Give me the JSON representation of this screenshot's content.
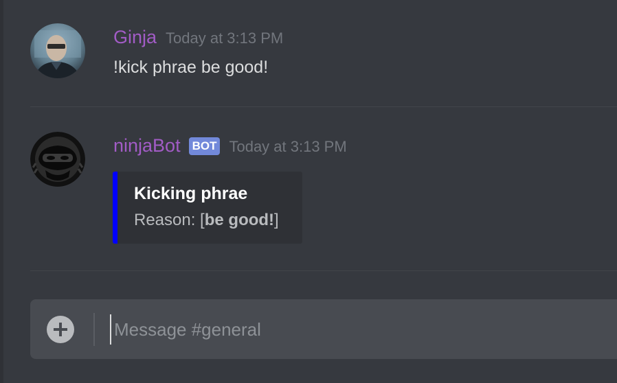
{
  "messages": [
    {
      "username": "Ginja",
      "timestamp": "Today at 3:13 PM",
      "content": "!kick phrae be good!",
      "avatar": "user-photo-avatar"
    },
    {
      "username": "ninjaBot",
      "bot_tag": "BOT",
      "timestamp": "Today at 3:13 PM",
      "avatar": "ninja-mask-avatar",
      "embed": {
        "color": "#0000ff",
        "title": "Kicking phrae",
        "reason_prefix": "Reason: [",
        "reason_bold": "be good!",
        "reason_suffix": "]"
      }
    }
  ],
  "composer": {
    "placeholder": "Message #general",
    "value": "",
    "upload_icon": "plus-circle-icon"
  },
  "colors": {
    "background": "#36393f",
    "username": "#a25cc6",
    "bot_tag": "#7289da",
    "embed_accent": "#0000ff",
    "composer": "#484b51"
  }
}
